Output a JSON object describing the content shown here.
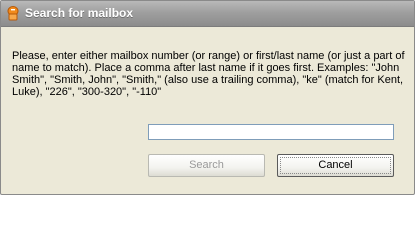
{
  "window": {
    "title": "Search for mailbox",
    "icon": "mailbox-icon"
  },
  "instructions": {
    "text": "Please, enter either mailbox number (or range) or first/last name (or just a part of name to match). Place a comma after last name if it goes first. Examples: \"John Smith\", \"Smith, John\", \"Smith,\" (also use a trailing comma), \"ke\" (match for Kent, Luke), \"226\", \"300-320\", \"-110\""
  },
  "search_field": {
    "value": "",
    "placeholder": ""
  },
  "buttons": {
    "search_label": "Search",
    "cancel_label": "Cancel"
  },
  "colors": {
    "dialog_bg": "#ece9d8",
    "titlebar": "#9f9f9f",
    "icon_orange": "#f08a1c"
  }
}
